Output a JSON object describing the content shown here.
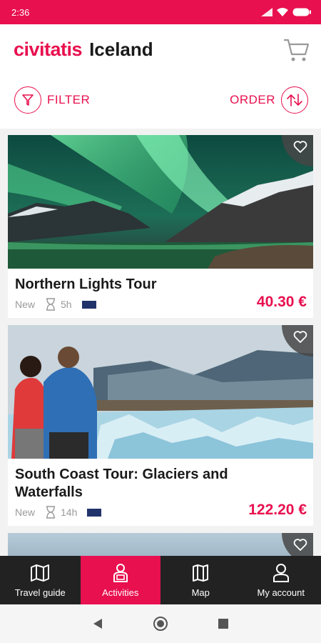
{
  "status": {
    "time": "2:36"
  },
  "header": {
    "logo": "civitatis",
    "city": "Iceland"
  },
  "filters": {
    "filter_label": "FILTER",
    "order_label": "ORDER"
  },
  "cards": [
    {
      "title": "Northern Lights Tour",
      "badge": "New",
      "duration": "5h",
      "price": "40.30 €"
    },
    {
      "title": "South Coast Tour: Glaciers and Waterfalls",
      "badge": "New",
      "duration": "14h",
      "price": "122.20 €"
    }
  ],
  "nav": [
    {
      "label": "Travel guide",
      "icon": "map-book-icon"
    },
    {
      "label": "Activities",
      "icon": "activities-icon"
    },
    {
      "label": "Map",
      "icon": "map-icon"
    },
    {
      "label": "My account",
      "icon": "user-icon"
    }
  ],
  "colors": {
    "accent": "#e8104f",
    "navbar": "#222222"
  }
}
